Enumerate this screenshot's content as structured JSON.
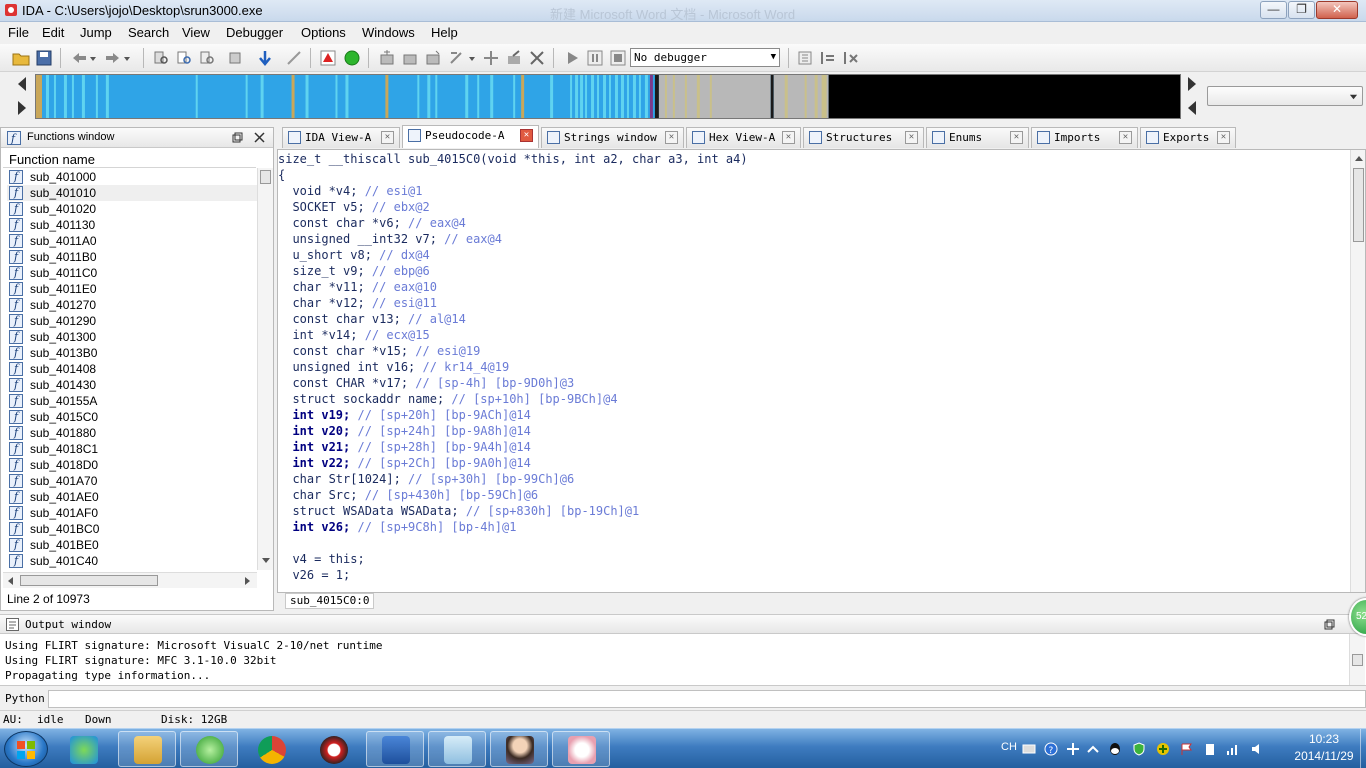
{
  "window": {
    "title": "IDA - C:\\Users\\jojo\\Desktop\\srun3000.exe",
    "background_title": "新建 Microsoft Word 文档 - Microsoft Word"
  },
  "menu": [
    "File",
    "Edit",
    "Jump",
    "Search",
    "View",
    "Debugger",
    "Options",
    "Windows",
    "Help"
  ],
  "toolbar": {
    "debugger_select": "No debugger"
  },
  "functions_window": {
    "title": "Functions window",
    "column_header": "Function name",
    "items": [
      "sub_401000",
      "sub_401010",
      "sub_401020",
      "sub_401130",
      "sub_4011A0",
      "sub_4011B0",
      "sub_4011C0",
      "sub_4011E0",
      "sub_401270",
      "sub_401290",
      "sub_401300",
      "sub_4013B0",
      "sub_401408",
      "sub_401430",
      "sub_40155A",
      "sub_4015C0",
      "sub_401880",
      "sub_4018C1",
      "sub_4018D0",
      "sub_401A70",
      "sub_401AE0",
      "sub_401AF0",
      "sub_401BC0",
      "sub_401BE0",
      "sub_401C40"
    ],
    "selected_index": 1,
    "status": "Line 2 of 10973"
  },
  "tabs": [
    {
      "label": "IDA View-A",
      "active": false
    },
    {
      "label": "Pseudocode-A",
      "active": true
    },
    {
      "label": "Strings window",
      "active": false
    },
    {
      "label": "Hex View-A",
      "active": false
    },
    {
      "label": "Structures",
      "active": false
    },
    {
      "label": "Enums",
      "active": false
    },
    {
      "label": "Imports",
      "active": false
    },
    {
      "label": "Exports",
      "active": false
    }
  ],
  "code": {
    "lines": [
      {
        "t": "size_t __thiscall sub_4015C0(void *this, int a2, char a3, int a4)",
        "c": ""
      },
      {
        "t": "{",
        "c": ""
      },
      {
        "t": "  void *v4; ",
        "c": "// esi@1"
      },
      {
        "t": "  SOCKET v5; ",
        "c": "// ebx@2"
      },
      {
        "t": "  const char *v6; ",
        "c": "// eax@4"
      },
      {
        "t": "  unsigned __int32 v7; ",
        "c": "// eax@4"
      },
      {
        "t": "  u_short v8; ",
        "c": "// dx@4"
      },
      {
        "t": "  size_t v9; ",
        "c": "// ebp@6"
      },
      {
        "t": "  char *v11; ",
        "c": "// eax@10"
      },
      {
        "t": "  char *v12; ",
        "c": "// esi@11"
      },
      {
        "t": "  const char v13; ",
        "c": "// al@14"
      },
      {
        "t": "  int *v14; ",
        "c": "// ecx@15"
      },
      {
        "t": "  const char *v15; ",
        "c": "// esi@19"
      },
      {
        "t": "  unsigned int v16; ",
        "c": "// kr14_4@19"
      },
      {
        "t": "  const CHAR *v17; ",
        "c": "// [sp-4h] [bp-9D0h]@3"
      },
      {
        "t": "  struct sockaddr name; ",
        "c": "// [sp+10h] [bp-9BCh]@4"
      },
      {
        "t": "  int v19; ",
        "c": "// [sp+20h] [bp-9ACh]@14",
        "bold": true
      },
      {
        "t": "  int v20; ",
        "c": "// [sp+24h] [bp-9A8h]@14",
        "bold": true
      },
      {
        "t": "  int v21; ",
        "c": "// [sp+28h] [bp-9A4h]@14",
        "bold": true
      },
      {
        "t": "  int v22; ",
        "c": "// [sp+2Ch] [bp-9A0h]@14",
        "bold": true
      },
      {
        "t": "  char Str[1024]; ",
        "c": "// [sp+30h] [bp-99Ch]@6"
      },
      {
        "t": "  char Src; ",
        "c": "// [sp+430h] [bp-59Ch]@6"
      },
      {
        "t": "  struct WSAData WSAData; ",
        "c": "// [sp+830h] [bp-19Ch]@1"
      },
      {
        "t": "  int v26; ",
        "c": "// [sp+9C8h] [bp-4h]@1",
        "bold": true
      },
      {
        "t": "",
        "c": ""
      },
      {
        "t": "  v4 = this;",
        "c": ""
      },
      {
        "t": "  v26 = 1;",
        "c": ""
      }
    ],
    "status": "sub_4015C0:0"
  },
  "output": {
    "title": "Output window",
    "lines": [
      "Using FLIRT signature: Microsoft VisualC 2-10/net runtime",
      "Using FLIRT signature: MFC 3.1-10.0 32bit",
      "Propagating type information..."
    ],
    "python_label": "Python"
  },
  "statusbar": {
    "au": "AU:",
    "state": "idle",
    "direction": "Down",
    "disk": "Disk: 12GB"
  },
  "taskbar": {
    "lang": "CH",
    "time": "10:23",
    "date": "2014/11/29",
    "badge": "52"
  },
  "colors": {
    "nav_blue": "#2fa4e7",
    "nav_cyan": "#5fd3f0",
    "nav_olive": "#c9c08a",
    "nav_gray": "#b8b8b8",
    "nav_black": "#000000"
  }
}
